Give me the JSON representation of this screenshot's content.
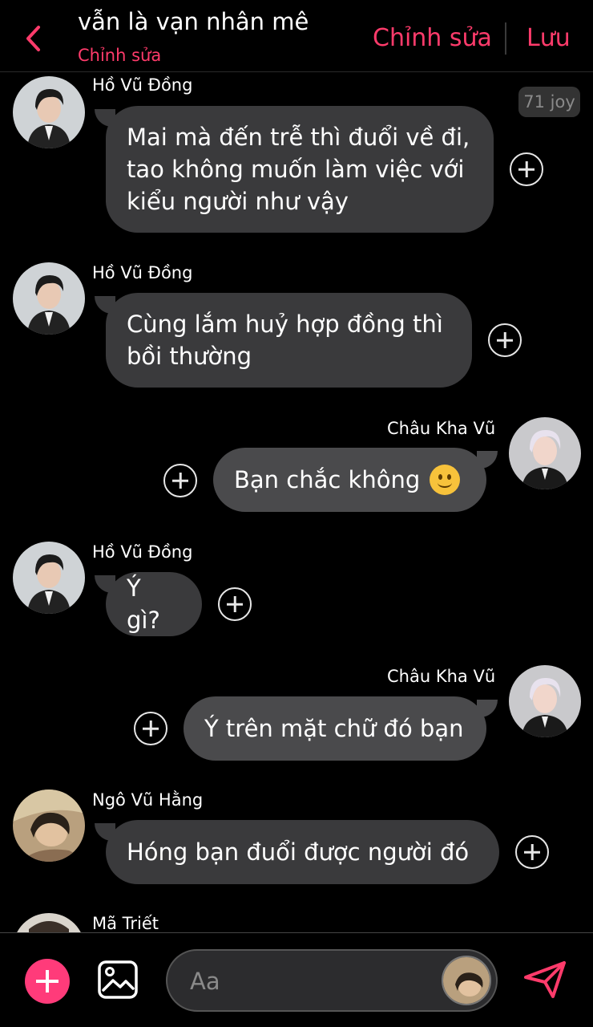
{
  "header": {
    "title": "vẫn là vạn nhân mê",
    "subtitle": "Chỉnh sửa",
    "edit_label": "Chỉnh sửa",
    "save_label": "Lưu"
  },
  "joy_badge": "71 joy",
  "messages": [
    {
      "sender": "Hồ Vũ Đồng",
      "direction": "incoming",
      "text": "Mai mà đến trễ thì đuổi về đi,\ntao không muốn làm việc với\nkiểu người như vậy"
    },
    {
      "sender": "Hồ Vũ Đồng",
      "direction": "incoming",
      "text": "Cùng lắm huỷ hợp đồng thì\nbồi thường"
    },
    {
      "sender": "Châu Kha Vũ",
      "direction": "outgoing",
      "text": "Bạn chắc không",
      "emoji": "slightly-smiling-face"
    },
    {
      "sender": "Hồ Vũ Đồng",
      "direction": "incoming",
      "text": "Ý gì?"
    },
    {
      "sender": "Châu Kha Vũ",
      "direction": "outgoing",
      "text": "Ý trên mặt chữ đó bạn"
    },
    {
      "sender": "Ngô Vũ Hằng",
      "direction": "incoming",
      "text": "Hóng bạn đuổi được người đó"
    },
    {
      "sender": "Mã Triết",
      "direction": "incoming",
      "text": ""
    }
  ],
  "composer": {
    "placeholder": "Aa"
  },
  "colors": {
    "accent": "#ff3b6b",
    "add_button": "#ff3b7a",
    "bubble_incoming": "#3a3a3c",
    "bubble_outgoing": "#4a4a4c",
    "background": "#000000"
  },
  "icons": {
    "back": "chevron-left-icon",
    "add": "plus-icon",
    "image": "image-icon",
    "send": "send-icon",
    "react": "plus-circle-icon"
  }
}
